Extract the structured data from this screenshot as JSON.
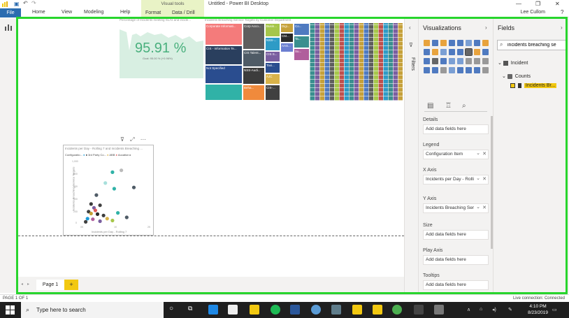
{
  "window": {
    "title": "Untitled - Power BI Desktop",
    "visual_tools_label": "Visual tools",
    "user": "Lee Cullom"
  },
  "ribbon": {
    "tabs": [
      "File",
      "Home",
      "View",
      "Modeling",
      "Help",
      "Format",
      "Data / Drill"
    ]
  },
  "canvas": {
    "kpi": {
      "title": "Percentage of Incidents meeting SLAs and incide...",
      "value": "95.91 %",
      "goal": "Goal: 95.00 % (+0.96%)"
    },
    "treemap": {
      "title": "Incidents Breaching Service Targets by Customer Department",
      "cells": [
        {
          "label": "Corporate Informati...",
          "color": "#f47b7b"
        },
        {
          "label": "CIS - Information Te...",
          "color": "#2a3f5e"
        },
        {
          "label": "Not Specified",
          "color": "#2a4d8f"
        },
        {
          "label": "",
          "color": "#30b2a7"
        },
        {
          "label": "Corp Acco...",
          "color": "#5e5e5e"
        },
        {
          "label": "CIS Talent...",
          "color": "#4f5b66"
        },
        {
          "label": "NSS-Audi...",
          "color": "#3c3c3c"
        },
        {
          "label": "Beha...",
          "color": "#f08a3c"
        },
        {
          "label": "Busin...",
          "color": "#a6c64a"
        },
        {
          "label": "NSS-...",
          "color": "#2e9bc6"
        },
        {
          "label": "CIS S...",
          "color": "#7a5fa0"
        },
        {
          "label": "Taxi...",
          "color": "#2a4d8f"
        },
        {
          "label": "AJC",
          "color": "#d9b34a"
        },
        {
          "label": "CIS-...",
          "color": "#404040"
        },
        {
          "label": "Digi...",
          "color": "#c6a13a"
        },
        {
          "label": "CM...",
          "color": "#2a2a2a"
        },
        {
          "label": "AAS...",
          "color": "#6b7fd1"
        },
        {
          "label": "Co...",
          "color": "#4f7ac0"
        },
        {
          "label": "Ta...",
          "color": "#3a8f8f"
        },
        {
          "label": "Su...",
          "color": "#b05e9c"
        }
      ]
    },
    "scatter": {
      "title": "Incidents per Day - Rolling 7 and Incidents Breaching ...",
      "legend_title": "Configuratio...",
      "legend_items": [
        {
          "label": "3rd Party Co...",
          "color": "#1d9bd8"
        },
        {
          "label": "ABB",
          "color": "#d9b34a"
        },
        {
          "label": "Aocation",
          "color": "#e05a5a"
        }
      ],
      "x_label": "Incidents per Day - Rolling 7",
      "y_label": "Incidents Breaching Service Targets",
      "y_ticks": [
        "1,000",
        "800",
        "600",
        "400",
        "200",
        "0"
      ],
      "x_ticks": [
        "0K",
        "1K",
        "2K"
      ]
    },
    "chart_data": {
      "type": "scatter",
      "title": "Incidents per Day - Rolling 7 and Incidents Breaching ...",
      "xlabel": "Incidents per Day - Rolling 7",
      "ylabel": "Incidents Breaching Service Targets",
      "xlim": [
        0,
        2000
      ],
      "ylim": [
        0,
        1000
      ],
      "points": [
        {
          "x": 900,
          "y": 820,
          "color": "#30b2a7"
        },
        {
          "x": 1150,
          "y": 850,
          "color": "#bbbbbb"
        },
        {
          "x": 700,
          "y": 650,
          "color": "#a8e0dc"
        },
        {
          "x": 950,
          "y": 560,
          "color": "#30b2a7"
        },
        {
          "x": 1500,
          "y": 580,
          "color": "#4f5b66"
        },
        {
          "x": 450,
          "y": 460,
          "color": "#4f5b66"
        },
        {
          "x": 300,
          "y": 320,
          "color": "#3c3c3c"
        },
        {
          "x": 550,
          "y": 300,
          "color": "#404040"
        },
        {
          "x": 380,
          "y": 260,
          "color": "#7a5fa0"
        },
        {
          "x": 420,
          "y": 220,
          "color": "#e05a5a"
        },
        {
          "x": 230,
          "y": 200,
          "color": "#404040"
        },
        {
          "x": 300,
          "y": 170,
          "color": "#c6a13a"
        },
        {
          "x": 480,
          "y": 160,
          "color": "#2a2a2a"
        },
        {
          "x": 650,
          "y": 140,
          "color": "#3c3c3c"
        },
        {
          "x": 1050,
          "y": 180,
          "color": "#30b2a7"
        },
        {
          "x": 1300,
          "y": 110,
          "color": "#4f5b66"
        },
        {
          "x": 750,
          "y": 90,
          "color": "#d9b34a"
        },
        {
          "x": 200,
          "y": 90,
          "color": "#1d9bd8"
        },
        {
          "x": 350,
          "y": 80,
          "color": "#b05e9c"
        },
        {
          "x": 900,
          "y": 60,
          "color": "#a6c64a"
        },
        {
          "x": 150,
          "y": 40,
          "color": "#404040"
        },
        {
          "x": 550,
          "y": 50,
          "color": "#7a5fa0"
        }
      ]
    }
  },
  "pages": {
    "tab_label": "Page 1",
    "add_label": "+",
    "status": "PAGE 1 OF 1"
  },
  "filters": {
    "label": "Filters"
  },
  "visualizations": {
    "title": "Visualizations",
    "wells": [
      {
        "label": "Details",
        "placeholder": "Add data fields here"
      },
      {
        "label": "Legend",
        "value": "Configuration Item"
      },
      {
        "label": "X Axis",
        "value": "Incidents per Day - Rolli"
      },
      {
        "label": "Y Axis",
        "value": "Incidents Breaching Ser"
      },
      {
        "label": "Size",
        "placeholder": "Add data fields here"
      },
      {
        "label": "Play Axis",
        "placeholder": "Add data fields here"
      },
      {
        "label": "Tooltips",
        "placeholder": "Add data fields here"
      }
    ]
  },
  "fields": {
    "title": "Fields",
    "search_value": "incidents breaching se",
    "table_name": "Incident",
    "folder_name": "Counts",
    "measure_name": "Incidents Br..."
  },
  "status": {
    "right": "Live connection: Connected"
  },
  "taskbar": {
    "search_placeholder": "Type here to search",
    "time": "4:10 PM",
    "date": "8/23/2019"
  },
  "colors": {
    "accent_yellow": "#f2c811",
    "file_tab": "#2b6cb0",
    "focus_border": "#28d52d",
    "kpi_green": "#49b07d"
  }
}
